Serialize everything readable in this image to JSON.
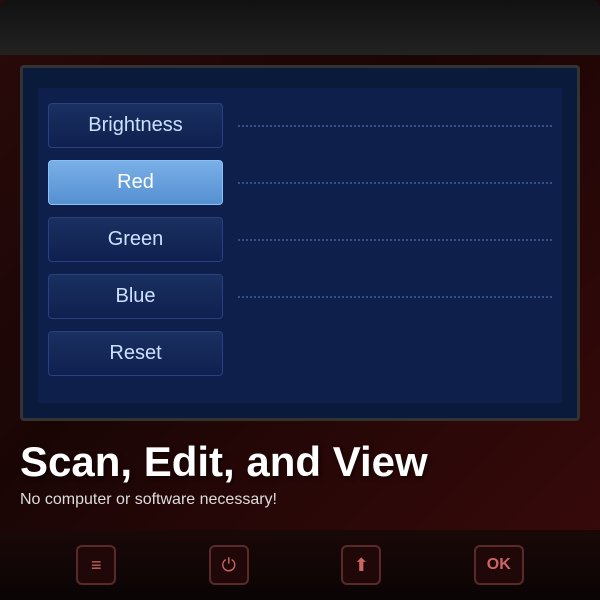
{
  "device": {
    "screen": {
      "menu_items": [
        {
          "label": "Brightness",
          "active": false,
          "has_line": true
        },
        {
          "label": "Red",
          "active": true,
          "has_line": true
        },
        {
          "label": "Green",
          "active": false,
          "has_line": true
        },
        {
          "label": "Blue",
          "active": false,
          "has_line": true
        },
        {
          "label": "Reset",
          "active": false,
          "has_line": false
        }
      ]
    },
    "tagline": "Scan, Edit, and View",
    "sub_tagline": "No computer or software necessary!",
    "bottom_icons": [
      {
        "name": "menu-icon",
        "symbol": "≡"
      },
      {
        "name": "power-icon",
        "symbol": "⏻"
      },
      {
        "name": "upload-icon",
        "symbol": "⬆"
      }
    ],
    "ok_label": "OK"
  }
}
